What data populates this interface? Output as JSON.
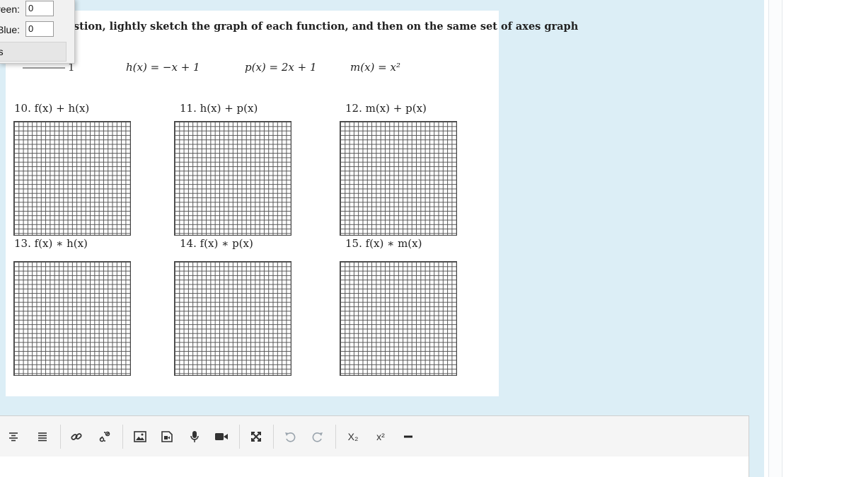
{
  "color_picker": {
    "green_label": "reen:",
    "green_value": "0",
    "blue_label": "Blue:",
    "blue_value": "0",
    "button_label": "rs"
  },
  "worksheet": {
    "instruction": "stion, lightly sketch the graph of each function, and then on the same set of axes graph",
    "functions_partial": "1",
    "functions": [
      "h(x) = −x + 1",
      "p(x) = 2x + 1",
      "m(x) = x²"
    ],
    "problems": [
      {
        "label": "10. f(x) + h(x)"
      },
      {
        "label": "11. h(x) + p(x)"
      },
      {
        "label": "12. m(x) + p(x)"
      },
      {
        "label": "13. f(x) ∗ h(x)"
      },
      {
        "label": "14. f(x) ∗ p(x)"
      },
      {
        "label": "15. f(x) ∗ m(x)"
      }
    ]
  },
  "toolbar": {
    "subscript_label": "X₂",
    "superscript_label": "x²",
    "icons": [
      "align-center-icon",
      "justify-icon",
      "link-icon",
      "unlink-icon",
      "image-icon",
      "media-icon",
      "microphone-icon",
      "video-icon",
      "fullscreen-icon",
      "undo-icon",
      "redo-icon",
      "subscript-icon",
      "superscript-icon",
      "horizontal-rule-icon"
    ]
  }
}
